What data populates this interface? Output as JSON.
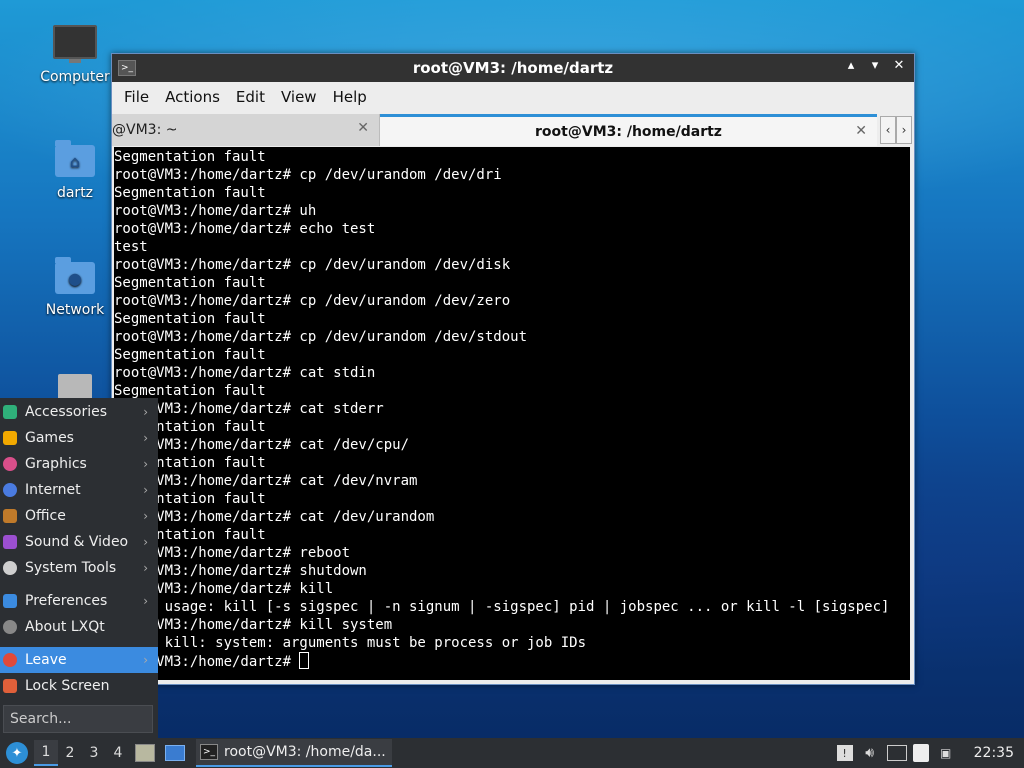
{
  "desktop": {
    "icons": [
      {
        "label": "Computer"
      },
      {
        "label": "dartz"
      },
      {
        "label": "Network"
      }
    ]
  },
  "window": {
    "title": "root@VM3: /home/dartz",
    "controls": {
      "minimize": "▴",
      "maximize": "▾",
      "close": "✕"
    },
    "menu": [
      "File",
      "Actions",
      "Edit",
      "View",
      "Help"
    ],
    "tabs": [
      {
        "label": "@VM3: ~",
        "active": false
      },
      {
        "label": "root@VM3: /home/dartz",
        "active": true
      }
    ],
    "terminal_lines": [
      "Segmentation fault",
      "root@VM3:/home/dartz# cp /dev/urandom /dev/dri",
      "Segmentation fault",
      "root@VM3:/home/dartz# uh",
      "root@VM3:/home/dartz# echo test",
      "test",
      "root@VM3:/home/dartz# cp /dev/urandom /dev/disk",
      "Segmentation fault",
      "root@VM3:/home/dartz# cp /dev/urandom /dev/zero",
      "Segmentation fault",
      "root@VM3:/home/dartz# cp /dev/urandom /dev/stdout",
      "Segmentation fault",
      "root@VM3:/home/dartz# cat stdin",
      "Segmentation fault",
      "root@VM3:/home/dartz# cat stderr",
      "Segmentation fault",
      "root@VM3:/home/dartz# cat /dev/cpu/",
      "Segmentation fault",
      "root@VM3:/home/dartz# cat /dev/nvram",
      "Segmentation fault",
      "root@VM3:/home/dartz# cat /dev/urandom",
      "Segmentation fault",
      "root@VM3:/home/dartz# reboot",
      "root@VM3:/home/dartz# shutdown",
      "root@VM3:/home/dartz# kill",
      "kill: usage: kill [-s sigspec | -n signum | -sigspec] pid | jobspec ... or kill -l [sigspec]",
      "root@VM3:/home/dartz# kill system",
      "bash: kill: system: arguments must be process or job IDs",
      "root@VM3:/home/dartz# "
    ]
  },
  "startmenu": {
    "items": [
      {
        "label": "Accessories",
        "icon": "accessories-icon",
        "color": "#2fb07a",
        "submenu": true
      },
      {
        "label": "Games",
        "icon": "games-icon",
        "color": "#f2a900",
        "submenu": true
      },
      {
        "label": "Graphics",
        "icon": "graphics-icon",
        "color": "#d94f8a",
        "submenu": true
      },
      {
        "label": "Internet",
        "icon": "internet-icon",
        "color": "#4a7be0",
        "submenu": true
      },
      {
        "label": "Office",
        "icon": "office-icon",
        "color": "#c07a2a",
        "submenu": true
      },
      {
        "label": "Sound & Video",
        "icon": "sound-video-icon",
        "color": "#9b4fd0",
        "submenu": true
      },
      {
        "label": "System Tools",
        "icon": "system-tools-icon",
        "color": "#cfcfcf",
        "submenu": true
      },
      {
        "label": "Preferences",
        "icon": "preferences-icon",
        "color": "#3b8be0",
        "submenu": true
      },
      {
        "label": "About LXQt",
        "icon": "info-icon",
        "color": "#888888",
        "submenu": false
      },
      {
        "label": "Leave",
        "icon": "power-icon",
        "color": "#e04a3a",
        "submenu": true
      },
      {
        "label": "Lock Screen",
        "icon": "lock-icon",
        "color": "#e0603a",
        "submenu": false
      }
    ],
    "search_placeholder": "Search..."
  },
  "taskbar": {
    "desktops": [
      "1",
      "2",
      "3",
      "4"
    ],
    "task_label": "root@VM3: /home/da...",
    "clock": "22:35"
  }
}
